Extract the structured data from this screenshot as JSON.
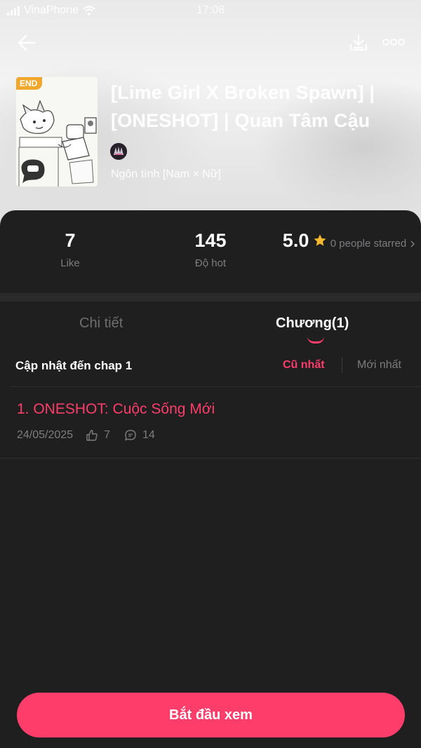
{
  "status_bar": {
    "carrier": "VinaPhone",
    "time": "17:08"
  },
  "header": {
    "badge": "END",
    "title": "[Lime Girl X Broken Spawn] | [ONESHOT] | Quan Tâm Cậu",
    "genre": "Ngôn tình [Nam × Nữ]",
    "icons": {
      "back": "back-arrow-icon",
      "download": "download-icon",
      "more": "more-icon"
    }
  },
  "stats": [
    {
      "value": "7",
      "label": "Like"
    },
    {
      "value": "145",
      "label": "Độ hot"
    },
    {
      "value": "5.0",
      "label": "0 people starred",
      "icon": "star-icon"
    }
  ],
  "colors": {
    "accent": "#ff3d6b",
    "star": "#f5b82e",
    "badge": "#f0a72c",
    "bg": "#1f1f20"
  },
  "tabs": [
    {
      "label": "Chi tiết",
      "active": false
    },
    {
      "label": "Chương(1)",
      "active": true
    }
  ],
  "chapter_list": {
    "update_text": "Cập nhật đến chap 1",
    "sort_oldest": "Cũ nhất",
    "sort_newest": "Mới nhất",
    "items": [
      {
        "title": "1. ONESHOT: Cuộc Sống Mới",
        "date": "24/05/2025",
        "likes": "7",
        "comments": "14"
      }
    ]
  },
  "start_button": "Bắt đầu xem"
}
